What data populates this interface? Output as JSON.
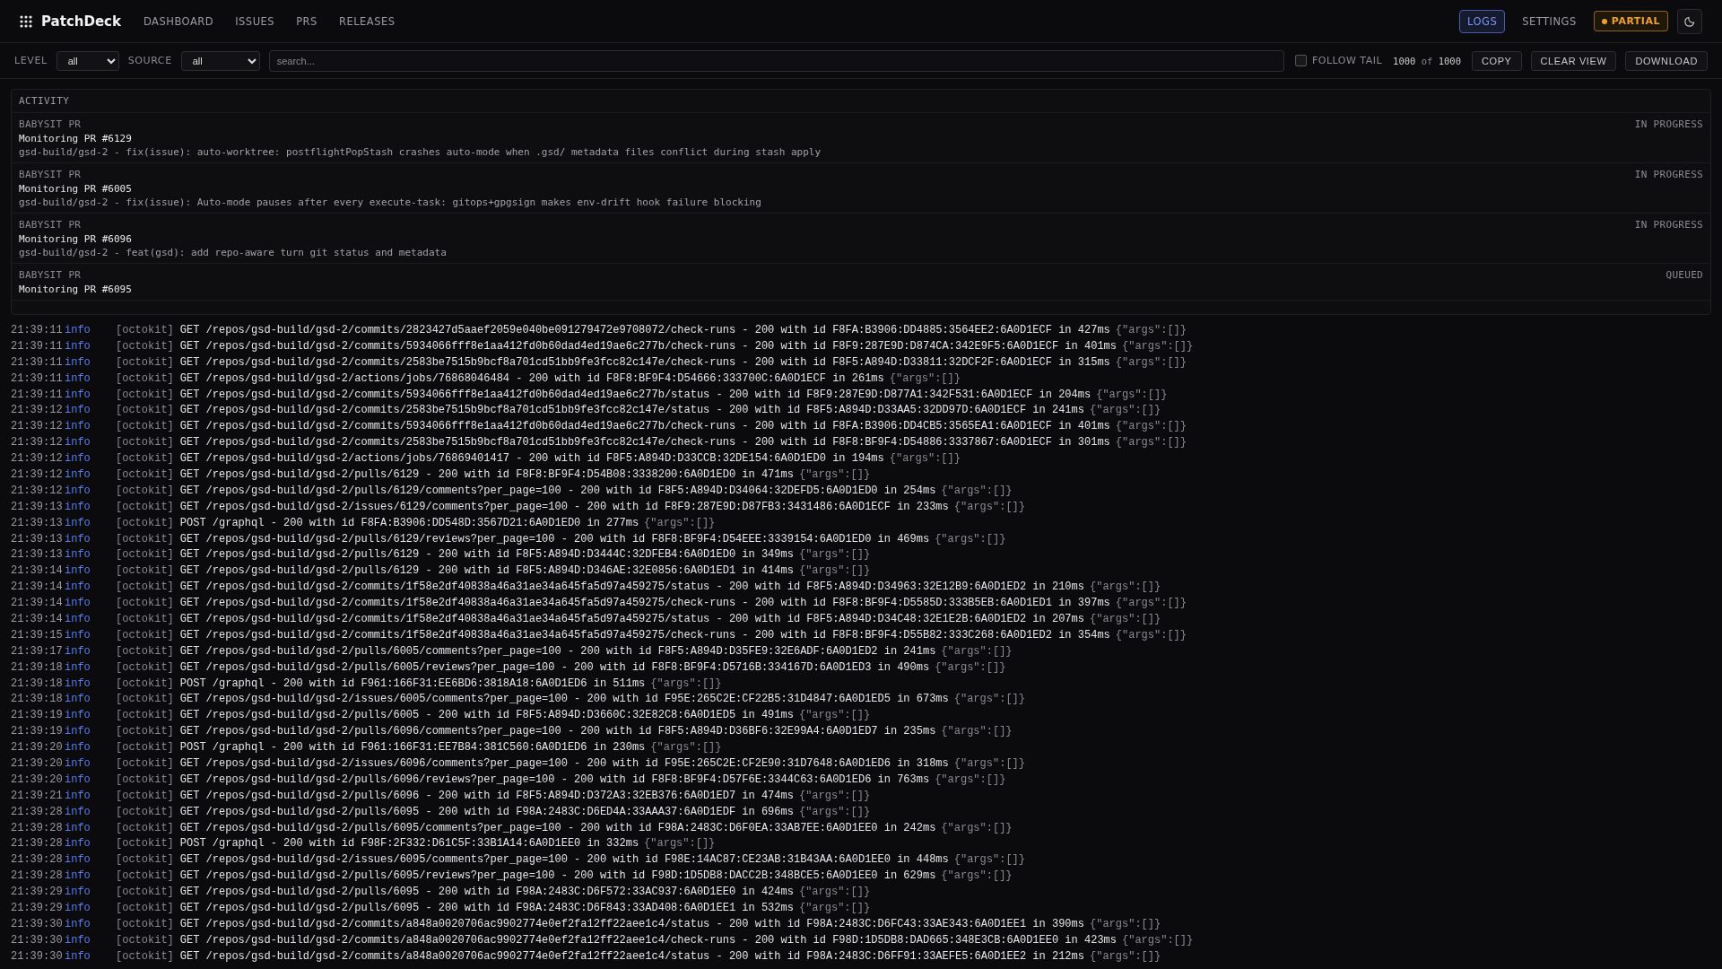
{
  "app": {
    "name": "PatchDeck"
  },
  "nav": [
    {
      "label": "DASHBOARD",
      "selected": false
    },
    {
      "label": "ISSUES",
      "selected": false
    },
    {
      "label": "PRS",
      "selected": false
    },
    {
      "label": "RELEASES",
      "selected": false
    }
  ],
  "right_nav": [
    {
      "label": "LOGS",
      "selected": true
    },
    {
      "label": "SETTINGS",
      "selected": false
    }
  ],
  "status_badge": {
    "label": "PARTIAL",
    "color": "#f0a030"
  },
  "toolbar": {
    "level_label": "LEVEL",
    "level_value": "all",
    "source_label": "SOURCE",
    "source_value": "all",
    "search": {
      "placeholder": "search..."
    },
    "follow_tail": {
      "label": "FOLLOW TAIL",
      "checked": false
    },
    "count": {
      "shown": "1000",
      "of": "of",
      "total": "1000"
    },
    "buttons": [
      "COPY",
      "CLEAR VIEW",
      "DOWNLOAD"
    ]
  },
  "activity": {
    "title": "ACTIVITY",
    "items": [
      {
        "kind": "BABYSIT PR",
        "title": "Monitoring PR #6129",
        "detail": "gsd-build/gsd-2 - fix(issue): auto-worktree: postflightPopStash crashes auto-mode when .gsd/ metadata files conflict during stash apply",
        "status": "IN PROGRESS"
      },
      {
        "kind": "BABYSIT PR",
        "title": "Monitoring PR #6005",
        "detail": "gsd-build/gsd-2 - fix(issue): Auto-mode pauses after every execute-task: gitops+gpgsign makes env-drift hook failure blocking",
        "status": "IN PROGRESS"
      },
      {
        "kind": "BABYSIT PR",
        "title": "Monitoring PR #6096",
        "detail": "gsd-build/gsd-2 - feat(gsd): add repo-aware turn git status and metadata",
        "status": "IN PROGRESS"
      },
      {
        "kind": "BABYSIT PR",
        "title": "Monitoring PR #6095",
        "status": "QUEUED"
      }
    ]
  },
  "logs": [
    {
      "time": "21:39:11",
      "level": "info",
      "source": "[octokit]",
      "message": "GET /repos/gsd-build/gsd-2/commits/2823427d5aaef2059e040be091279472e9708072/check-runs - 200 with id F8FA:B3906:DD4885:3564EE2:6A0D1ECF in 427ms",
      "args": "{\"args\":[]}"
    },
    {
      "time": "21:39:11",
      "level": "info",
      "source": "[octokit]",
      "message": "GET /repos/gsd-build/gsd-2/commits/5934066fff8e1aa412fd0b60dad4ed19ae6c277b/check-runs - 200 with id F8F9:287E9D:D874CA:342E9F5:6A0D1ECF in 401ms",
      "args": "{\"args\":[]}"
    },
    {
      "time": "21:39:11",
      "level": "info",
      "source": "[octokit]",
      "message": "GET /repos/gsd-build/gsd-2/commits/2583be7515b9bcf8a701cd51bb9fe3fcc82c147e/check-runs - 200 with id F8F5:A894D:D33811:32DCF2F:6A0D1ECF in 315ms",
      "args": "{\"args\":[]}"
    },
    {
      "time": "21:39:11",
      "level": "info",
      "source": "[octokit]",
      "message": "GET /repos/gsd-build/gsd-2/actions/jobs/76868046484 - 200 with id F8F8:BF9F4:D54666:333700C:6A0D1ECF in 261ms",
      "args": "{\"args\":[]}"
    },
    {
      "time": "21:39:11",
      "level": "info",
      "source": "[octokit]",
      "message": "GET /repos/gsd-build/gsd-2/commits/5934066fff8e1aa412fd0b60dad4ed19ae6c277b/status - 200 with id F8F9:287E9D:D877A1:342F531:6A0D1ECF in 204ms",
      "args": "{\"args\":[]}"
    },
    {
      "time": "21:39:12",
      "level": "info",
      "source": "[octokit]",
      "message": "GET /repos/gsd-build/gsd-2/commits/2583be7515b9bcf8a701cd51bb9fe3fcc82c147e/status - 200 with id F8F5:A894D:D33AA5:32DD97D:6A0D1ECF in 241ms",
      "args": "{\"args\":[]}"
    },
    {
      "time": "21:39:12",
      "level": "info",
      "source": "[octokit]",
      "message": "GET /repos/gsd-build/gsd-2/commits/5934066fff8e1aa412fd0b60dad4ed19ae6c277b/check-runs - 200 with id F8FA:B3906:DD4CB5:3565EA1:6A0D1ECF in 401ms",
      "args": "{\"args\":[]}"
    },
    {
      "time": "21:39:12",
      "level": "info",
      "source": "[octokit]",
      "message": "GET /repos/gsd-build/gsd-2/commits/2583be7515b9bcf8a701cd51bb9fe3fcc82c147e/check-runs - 200 with id F8F8:BF9F4:D54886:3337867:6A0D1ECF in 301ms",
      "args": "{\"args\":[]}"
    },
    {
      "time": "21:39:12",
      "level": "info",
      "source": "[octokit]",
      "message": "GET /repos/gsd-build/gsd-2/actions/jobs/76869401417 - 200 with id F8F5:A894D:D33CCB:32DE154:6A0D1ED0 in 194ms",
      "args": "{\"args\":[]}"
    },
    {
      "time": "21:39:12",
      "level": "info",
      "source": "[octokit]",
      "message": "GET /repos/gsd-build/gsd-2/pulls/6129 - 200 with id F8F8:BF9F4:D54B08:3338200:6A0D1ED0 in 471ms",
      "args": "{\"args\":[]}"
    },
    {
      "time": "21:39:12",
      "level": "info",
      "source": "[octokit]",
      "message": "GET /repos/gsd-build/gsd-2/pulls/6129/comments?per_page=100 - 200 with id F8F5:A894D:D34064:32DEFD5:6A0D1ED0 in 254ms",
      "args": "{\"args\":[]}"
    },
    {
      "time": "21:39:13",
      "level": "info",
      "source": "[octokit]",
      "message": "GET /repos/gsd-build/gsd-2/issues/6129/comments?per_page=100 - 200 with id F8F9:287E9D:D87FB3:3431486:6A0D1ECF in 233ms",
      "args": "{\"args\":[]}"
    },
    {
      "time": "21:39:13",
      "level": "info",
      "source": "[octokit]",
      "message": "POST /graphql - 200 with id F8FA:B3906:DD548D:3567D21:6A0D1ED0 in 277ms",
      "args": "{\"args\":[]}"
    },
    {
      "time": "21:39:13",
      "level": "info",
      "source": "[octokit]",
      "message": "GET /repos/gsd-build/gsd-2/pulls/6129/reviews?per_page=100 - 200 with id F8F8:BF9F4:D54EEE:3339154:6A0D1ED0 in 469ms",
      "args": "{\"args\":[]}"
    },
    {
      "time": "21:39:13",
      "level": "info",
      "source": "[octokit]",
      "message": "GET /repos/gsd-build/gsd-2/pulls/6129 - 200 with id F8F5:A894D:D3444C:32DFEB4:6A0D1ED0 in 349ms",
      "args": "{\"args\":[]}"
    },
    {
      "time": "21:39:14",
      "level": "info",
      "source": "[octokit]",
      "message": "GET /repos/gsd-build/gsd-2/pulls/6129 - 200 with id F8F5:A894D:D346AE:32E0856:6A0D1ED1 in 414ms",
      "args": "{\"args\":[]}"
    },
    {
      "time": "21:39:14",
      "level": "info",
      "source": "[octokit]",
      "message": "GET /repos/gsd-build/gsd-2/commits/1f58e2df40838a46a31ae34a645fa5d97a459275/status - 200 with id F8F5:A894D:D34963:32E12B9:6A0D1ED2 in 210ms",
      "args": "{\"args\":[]}"
    },
    {
      "time": "21:39:14",
      "level": "info",
      "source": "[octokit]",
      "message": "GET /repos/gsd-build/gsd-2/commits/1f58e2df40838a46a31ae34a645fa5d97a459275/check-runs - 200 with id F8F8:BF9F4:D5585D:333B5EB:6A0D1ED1 in 397ms",
      "args": "{\"args\":[]}"
    },
    {
      "time": "21:39:14",
      "level": "info",
      "source": "[octokit]",
      "message": "GET /repos/gsd-build/gsd-2/commits/1f58e2df40838a46a31ae34a645fa5d97a459275/status - 200 with id F8F5:A894D:D34C48:32E1E2B:6A0D1ED2 in 207ms",
      "args": "{\"args\":[]}"
    },
    {
      "time": "21:39:15",
      "level": "info",
      "source": "[octokit]",
      "message": "GET /repos/gsd-build/gsd-2/commits/1f58e2df40838a46a31ae34a645fa5d97a459275/check-runs - 200 with id F8F8:BF9F4:D55B82:333C268:6A0D1ED2 in 354ms",
      "args": "{\"args\":[]}"
    },
    {
      "time": "21:39:17",
      "level": "info",
      "source": "[octokit]",
      "message": "GET /repos/gsd-build/gsd-2/pulls/6005/comments?per_page=100 - 200 with id F8F5:A894D:D35FE9:32E6ADF:6A0D1ED2 in 241ms",
      "args": "{\"args\":[]}"
    },
    {
      "time": "21:39:18",
      "level": "info",
      "source": "[octokit]",
      "message": "GET /repos/gsd-build/gsd-2/pulls/6005/reviews?per_page=100 - 200 with id F8F8:BF9F4:D5716B:334167D:6A0D1ED3 in 490ms",
      "args": "{\"args\":[]}"
    },
    {
      "time": "21:39:18",
      "level": "info",
      "source": "[octokit]",
      "message": "POST /graphql - 200 with id F961:166F31:EE6BD6:3818A18:6A0D1ED6 in 511ms",
      "args": "{\"args\":[]}"
    },
    {
      "time": "21:39:18",
      "level": "info",
      "source": "[octokit]",
      "message": "GET /repos/gsd-build/gsd-2/issues/6005/comments?per_page=100 - 200 with id F95E:265C2E:CF22B5:31D4847:6A0D1ED5 in 673ms",
      "args": "{\"args\":[]}"
    },
    {
      "time": "21:39:19",
      "level": "info",
      "source": "[octokit]",
      "message": "GET /repos/gsd-build/gsd-2/pulls/6005 - 200 with id F8F5:A894D:D3660C:32E82C8:6A0D1ED5 in 491ms",
      "args": "{\"args\":[]}"
    },
    {
      "time": "21:39:19",
      "level": "info",
      "source": "[octokit]",
      "message": "GET /repos/gsd-build/gsd-2/pulls/6096/comments?per_page=100 - 200 with id F8F5:A894D:D36BF6:32E99A4:6A0D1ED7 in 235ms",
      "args": "{\"args\":[]}"
    },
    {
      "time": "21:39:20",
      "level": "info",
      "source": "[octokit]",
      "message": "POST /graphql - 200 with id F961:166F31:EE7B84:381C560:6A0D1ED6 in 230ms",
      "args": "{\"args\":[]}"
    },
    {
      "time": "21:39:20",
      "level": "info",
      "source": "[octokit]",
      "message": "GET /repos/gsd-build/gsd-2/issues/6096/comments?per_page=100 - 200 with id F95E:265C2E:CF2E90:31D7648:6A0D1ED6 in 318ms",
      "args": "{\"args\":[]}"
    },
    {
      "time": "21:39:20",
      "level": "info",
      "source": "[octokit]",
      "message": "GET /repos/gsd-build/gsd-2/pulls/6096/reviews?per_page=100 - 200 with id F8F8:BF9F4:D57F6E:3344C63:6A0D1ED6 in 763ms",
      "args": "{\"args\":[]}"
    },
    {
      "time": "21:39:21",
      "level": "info",
      "source": "[octokit]",
      "message": "GET /repos/gsd-build/gsd-2/pulls/6096 - 200 with id F8F5:A894D:D372A3:32EB376:6A0D1ED7 in 474ms",
      "args": "{\"args\":[]}"
    },
    {
      "time": "21:39:28",
      "level": "info",
      "source": "[octokit]",
      "message": "GET /repos/gsd-build/gsd-2/pulls/6095 - 200 with id F98A:2483C:D6ED4A:33AAA37:6A0D1EDF in 696ms",
      "args": "{\"args\":[]}"
    },
    {
      "time": "21:39:28",
      "level": "info",
      "source": "[octokit]",
      "message": "GET /repos/gsd-build/gsd-2/pulls/6095/comments?per_page=100 - 200 with id F98A:2483C:D6F0EA:33AB7EE:6A0D1EE0 in 242ms",
      "args": "{\"args\":[]}"
    },
    {
      "time": "21:39:28",
      "level": "info",
      "source": "[octokit]",
      "message": "POST /graphql - 200 with id F98F:2F332:D61C5F:33B1A14:6A0D1EE0 in 332ms",
      "args": "{\"args\":[]}"
    },
    {
      "time": "21:39:28",
      "level": "info",
      "source": "[octokit]",
      "message": "GET /repos/gsd-build/gsd-2/issues/6095/comments?per_page=100 - 200 with id F98E:14AC87:CE23AB:31B43AA:6A0D1EE0 in 448ms",
      "args": "{\"args\":[]}"
    },
    {
      "time": "21:39:28",
      "level": "info",
      "source": "[octokit]",
      "message": "GET /repos/gsd-build/gsd-2/pulls/6095/reviews?per_page=100 - 200 with id F98D:1D5DB8:DACC2B:348BCE5:6A0D1EE0 in 629ms",
      "args": "{\"args\":[]}"
    },
    {
      "time": "21:39:29",
      "level": "info",
      "source": "[octokit]",
      "message": "GET /repos/gsd-build/gsd-2/pulls/6095 - 200 with id F98A:2483C:D6F572:33AC937:6A0D1EE0 in 424ms",
      "args": "{\"args\":[]}"
    },
    {
      "time": "21:39:29",
      "level": "info",
      "source": "[octokit]",
      "message": "GET /repos/gsd-build/gsd-2/pulls/6095 - 200 with id F98A:2483C:D6F843:33AD408:6A0D1EE1 in 532ms",
      "args": "{\"args\":[]}"
    },
    {
      "time": "21:39:30",
      "level": "info",
      "source": "[octokit]",
      "message": "GET /repos/gsd-build/gsd-2/commits/a848a0020706ac9902774e0ef2fa12ff22aee1c4/status - 200 with id F98A:2483C:D6FC43:33AE343:6A0D1EE1 in 390ms",
      "args": "{\"args\":[]}"
    },
    {
      "time": "21:39:30",
      "level": "info",
      "source": "[octokit]",
      "message": "GET /repos/gsd-build/gsd-2/commits/a848a0020706ac9902774e0ef2fa12ff22aee1c4/check-runs - 200 with id F98D:1D5DB8:DAD665:348E3CB:6A0D1EE0 in 423ms",
      "args": "{\"args\":[]}"
    },
    {
      "time": "21:39:30",
      "level": "info",
      "source": "[octokit]",
      "message": "GET /repos/gsd-build/gsd-2/commits/a848a0020706ac9902774e0ef2fa12ff22aee1c4/status - 200 with id F98A:2483C:D6FF91:33AEFE5:6A0D1EE2 in 212ms",
      "args": "{\"args\":[]}"
    }
  ]
}
